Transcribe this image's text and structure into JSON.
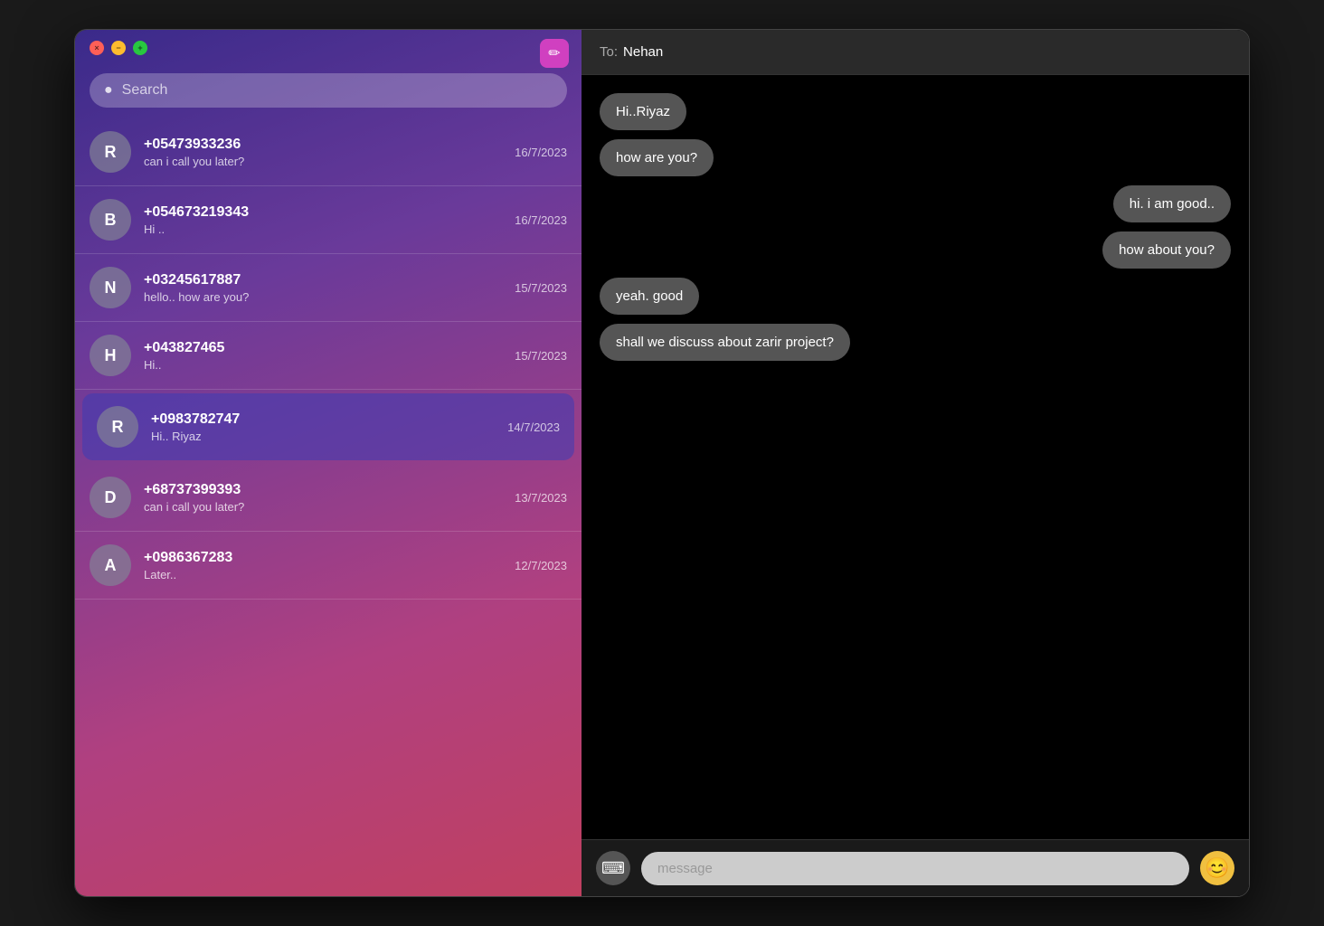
{
  "window": {
    "close_label": "×",
    "minimize_label": "−",
    "maximize_label": "+"
  },
  "compose": {
    "icon": "✏️"
  },
  "search": {
    "placeholder": "Search"
  },
  "contacts": [
    {
      "id": "R1",
      "initial": "R",
      "phone": "+05473933236",
      "preview": "can  i call you later?",
      "date": "16/7/2023",
      "active": false
    },
    {
      "id": "B1",
      "initial": "B",
      "phone": "+054673219343",
      "preview": "Hi ..",
      "date": "16/7/2023",
      "active": false
    },
    {
      "id": "N1",
      "initial": "N",
      "phone": "+03245617887",
      "preview": "hello.. how are you?",
      "date": "15/7/2023",
      "active": false
    },
    {
      "id": "H1",
      "initial": "H",
      "phone": "+043827465",
      "preview": "Hi..",
      "date": "15/7/2023",
      "active": false
    },
    {
      "id": "R2",
      "initial": "R",
      "phone": "+0983782747",
      "preview": "Hi.. Riyaz",
      "date": "14/7/2023",
      "active": true
    },
    {
      "id": "D1",
      "initial": "D",
      "phone": "+68737399393",
      "preview": "can i call you later?",
      "date": "13/7/2023",
      "active": false
    },
    {
      "id": "A1",
      "initial": "A",
      "phone": "+0986367283",
      "preview": "Later..",
      "date": "12/7/2023",
      "active": false
    }
  ],
  "chat": {
    "to_label": "To:",
    "to_name": "Nehan",
    "messages": [
      {
        "id": "m1",
        "text": "Hi..Riyaz",
        "type": "received"
      },
      {
        "id": "m2",
        "text": "how are you?",
        "type": "received"
      },
      {
        "id": "m3",
        "text": "hi. i am good..",
        "type": "sent"
      },
      {
        "id": "m4",
        "text": "how about you?",
        "type": "sent"
      },
      {
        "id": "m5",
        "text": "yeah. good",
        "type": "received"
      },
      {
        "id": "m6",
        "text": "shall we discuss about zarir project?",
        "type": "received"
      }
    ],
    "input_placeholder": "message",
    "emoji_icon": "😊"
  }
}
